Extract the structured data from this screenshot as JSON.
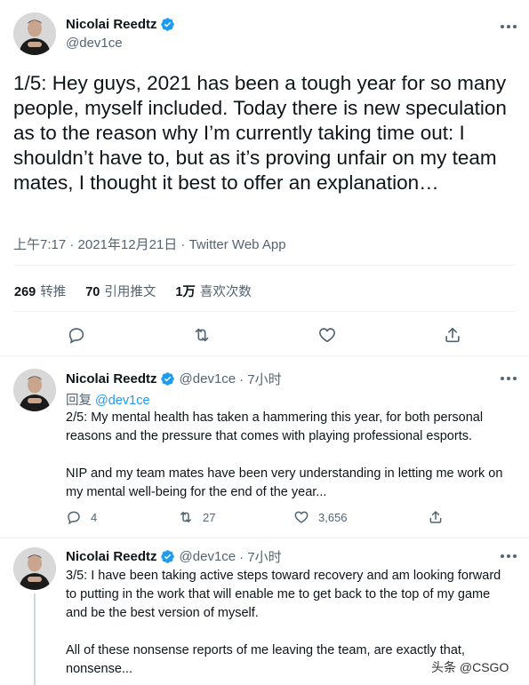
{
  "author": {
    "display_name": "Nicolai Reedtz",
    "handle": "@dev1ce",
    "verified": true
  },
  "main_tweet": {
    "text": "1/5: Hey guys, 2021 has been a tough year for so many people, myself included. Today there is new speculation as to the reason why I’m currently taking time out: I shouldn’t have to, but as it’s proving unfair on my team mates, I thought it best to offer an explanation…",
    "timestamp": "上午7:17 · 2021年12月21日 · Twitter Web App",
    "stats": {
      "retweets_count": "269",
      "retweets_label": "转推",
      "quotes_count": "70",
      "quotes_label": "引用推文",
      "likes_count": "1万",
      "likes_label": "喜欢次数"
    },
    "actions": [
      "reply-icon",
      "retweet-icon",
      "like-icon",
      "share-icon"
    ]
  },
  "replies": [
    {
      "display_name": "Nicolai Reedtz",
      "handle": "@dev1ce",
      "time": "· 7小时",
      "reply_label": "回复",
      "reply_to": "@dev1ce",
      "paragraphs": [
        "2/5: My mental health has taken a hammering this year, for both personal reasons and the pressure that comes with playing professional esports.",
        "NIP and my team mates have been very understanding in letting me work on my mental well-being for the end of the year..."
      ],
      "reply_count": "4",
      "retweet_count": "27",
      "like_count": "3,656"
    },
    {
      "display_name": "Nicolai Reedtz",
      "handle": "@dev1ce",
      "time": "· 7小时",
      "paragraphs": [
        "3/5:  I have been taking active steps toward recovery and am looking forward to putting in the work that will enable me to get back to the top of my game and be the best version of myself.",
        "All of these nonsense reports of me leaving the team, are exactly that, nonsense..."
      ]
    }
  ],
  "watermark": "头条 @CSGO",
  "colors": {
    "accent": "#1d9bf0",
    "text": "#0f1419",
    "secondary": "#536471",
    "border": "#eff3f4"
  }
}
